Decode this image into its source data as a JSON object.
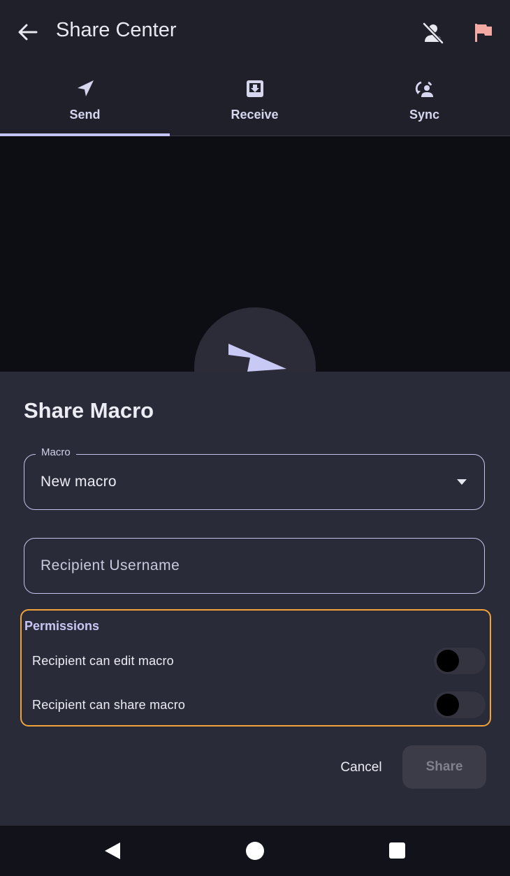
{
  "app_bar": {
    "title": "Share Center",
    "icons": [
      "back-arrow-icon",
      "person-off-icon",
      "flag-icon"
    ],
    "flag_color": "#f4a9a3"
  },
  "tabs": [
    {
      "label": "Send",
      "icon": "navigation-arrow-icon",
      "active": true
    },
    {
      "label": "Receive",
      "icon": "download-box-icon",
      "active": false
    },
    {
      "label": "Sync",
      "icon": "account-sync-icon",
      "active": false
    }
  ],
  "sheet": {
    "title": "Share Macro",
    "macro_field": {
      "legend": "Macro",
      "value": "New macro"
    },
    "recipient_field": {
      "placeholder": "Recipient Username",
      "value": ""
    },
    "permissions": {
      "title": "Permissions",
      "items": [
        {
          "label": "Recipient can edit macro",
          "enabled": false
        },
        {
          "label": "Recipient can share macro",
          "enabled": false
        }
      ]
    },
    "cancel_label": "Cancel",
    "share_label": "Share"
  },
  "colors": {
    "accent": "#c3c4f4",
    "highlight_border": "#f2a33a",
    "sheet_bg": "#2a2b38"
  }
}
